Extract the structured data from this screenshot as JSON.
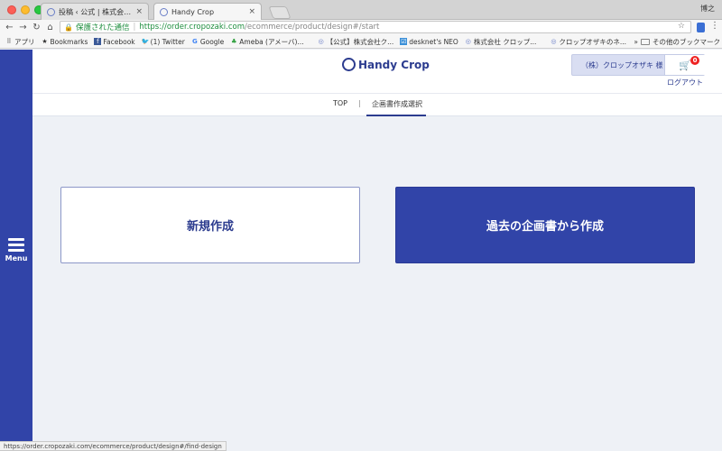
{
  "browser": {
    "tabs": [
      {
        "title": "投稿 ‹ 公式 | 株式会社クロップ",
        "close": "×"
      },
      {
        "title": "Handy Crop",
        "close": "×"
      }
    ],
    "profile": "博之",
    "nav_buttons": {
      "back": "←",
      "forward": "→",
      "reload": "↻",
      "home": "⌂"
    },
    "address": {
      "lock": "🔒",
      "secure_label": "保護された通信",
      "separator": "|",
      "url_host": "https://order.cropozaki.com",
      "url_path": "/ecommerce/product/design#/start",
      "star": "☆"
    },
    "menu_glyph": "⋮",
    "bookmarks": [
      {
        "icon": "grid-icon",
        "glyph": "⠿",
        "label": "アプリ"
      },
      {
        "icon": "star-icon",
        "glyph": "★",
        "label": "Bookmarks"
      },
      {
        "icon": "facebook-icon",
        "glyph": "f",
        "label": "Facebook"
      },
      {
        "icon": "twitter-icon",
        "glyph": "🐦",
        "label": "(1) Twitter"
      },
      {
        "icon": "google-icon",
        "glyph": "G",
        "label": "Google"
      },
      {
        "icon": "ameba-icon",
        "glyph": "♣",
        "label": "Ameba (アメーバ)..."
      },
      {
        "icon": "crop-icon",
        "glyph": "◎",
        "label": "【公式】株式会社ク..."
      },
      {
        "icon": "desknets-icon",
        "glyph": "☑",
        "label": "desknet's NEO"
      },
      {
        "icon": "crop-icon",
        "glyph": "◎",
        "label": "株式会社 クロップ..."
      },
      {
        "icon": "crop-icon",
        "glyph": "◎",
        "label": "クロップオザキのネ..."
      }
    ],
    "bookmarks_more": {
      "chevron": "»",
      "label": "その他のブックマーク"
    },
    "status_url": "https://order.cropozaki.com/ecommerce/product/design#/find-design"
  },
  "sidebar": {
    "label": "Menu"
  },
  "header": {
    "logo_text": "Handy Crop",
    "user_name": "（株）クロップオザキ 様",
    "cart_icon": "🛒",
    "cart_count": "0",
    "logout": "ログアウト"
  },
  "nav": {
    "top": "TOP",
    "separator": "|",
    "current": "企画書作成選択"
  },
  "actions": {
    "new": "新規作成",
    "from_past": "過去の企画書から作成"
  },
  "colors": {
    "brand": "#3144a8",
    "brand_dark": "#2c3c8f",
    "page_bg": "#eef1f6",
    "badge": "#e22222"
  }
}
